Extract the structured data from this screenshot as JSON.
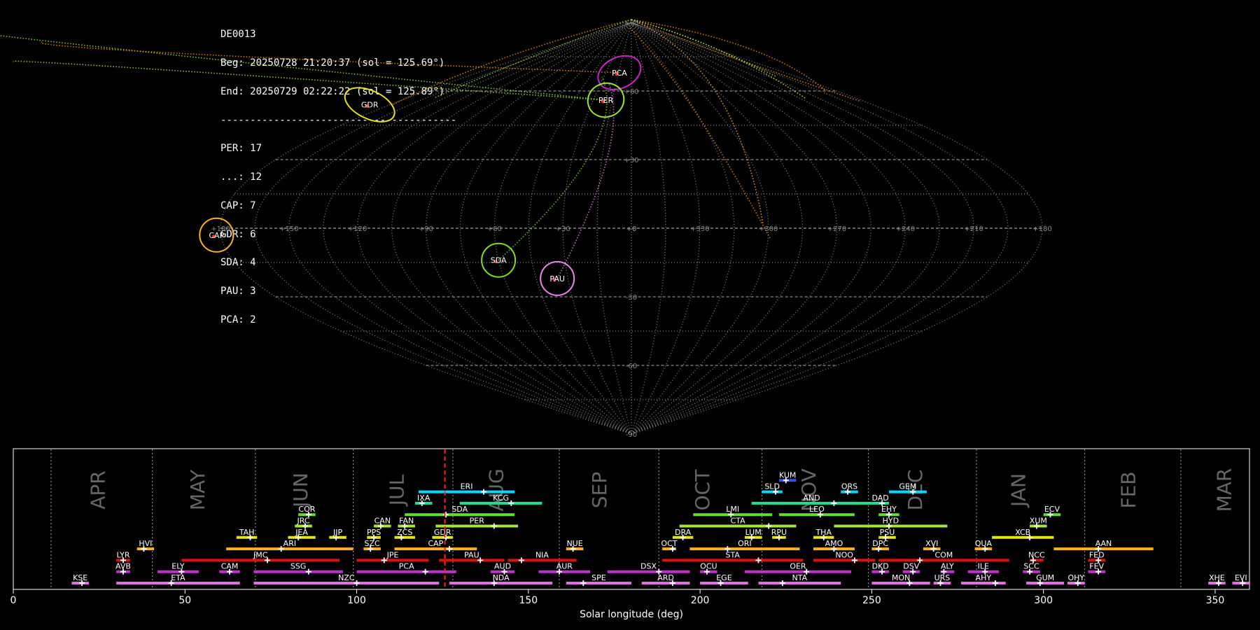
{
  "info": {
    "station": "DE0013",
    "begin": "Beg: 20250728 21:20:37 (sol = 125.69°)",
    "end": "End: 20250729 02:22:22 (sol = 125.89°)",
    "separator": "----------------------------------------",
    "counts": [
      "PER: 17",
      "...: 12",
      "CAP: 7",
      "GDR: 6",
      "SDA: 4",
      "PAU: 3",
      "PCA: 2"
    ]
  },
  "colors": {
    "background": "#000000",
    "PER": "#99e632",
    "CAP": "#ffb020",
    "GDR": "#e6e020",
    "SDA": "#80e020",
    "PAU": "#ee82ee",
    "PCA": "#cc22cc",
    "sporadic": "#ff8800",
    "current_sol": "#ff2020"
  },
  "chart_data": [
    {
      "type": "scatter",
      "projection": "sinusoidal",
      "lon_labels": [
        "+180",
        "+150",
        "+120",
        "+90",
        "+60",
        "+30",
        "+0",
        "+330",
        "+300",
        "+270",
        "+240",
        "+210",
        "+180"
      ],
      "lat_labels": [
        "+90",
        "+60",
        "+30",
        "+0",
        "-30",
        "-60",
        "-90"
      ],
      "radiants": [
        {
          "name": "PCA",
          "lon": -14,
          "lat": 68
        },
        {
          "name": "PER",
          "lon": -20,
          "lat": 56
        },
        {
          "name": "GDR",
          "lon": -195,
          "lat": 54
        },
        {
          "name": "CAP",
          "lon": -182,
          "lat": -3
        },
        {
          "name": "SDA",
          "lon": -60,
          "lat": -14
        },
        {
          "name": "PAU",
          "lon": -35,
          "lat": -22
        }
      ]
    },
    {
      "type": "bar",
      "xlabel": "Solar longitude (deg)",
      "xlim": [
        0,
        360
      ],
      "xticks": [
        0,
        50,
        100,
        150,
        200,
        250,
        300,
        350
      ],
      "current_sol": 125.69,
      "month_boundaries": [
        11,
        40.5,
        70.5,
        99,
        128,
        159,
        188,
        218,
        249,
        280.5,
        312,
        340
      ],
      "months": [
        {
          "name": "APR",
          "sol": 25
        },
        {
          "name": "MAY",
          "sol": 54
        },
        {
          "name": "JUN",
          "sol": 84
        },
        {
          "name": "JUL",
          "sol": 112
        },
        {
          "name": "AUG",
          "sol": 141
        },
        {
          "name": "SEP",
          "sol": 171
        },
        {
          "name": "OCT",
          "sol": 201
        },
        {
          "name": "NOV",
          "sol": 232
        },
        {
          "name": "DEC",
          "sol": 263
        },
        {
          "name": "JAN",
          "sol": 293
        },
        {
          "name": "FEB",
          "sol": 325
        },
        {
          "name": "MAR",
          "sol": 353
        }
      ],
      "showers": [
        {
          "name": "KUM",
          "start": 223,
          "end": 228,
          "peak": 225,
          "row": 10,
          "color": "#3050ff"
        },
        {
          "name": "ERI",
          "start": 118,
          "end": 146,
          "peak": 137,
          "row": 9,
          "color": "#00d8ff"
        },
        {
          "name": "SLD",
          "start": 218,
          "end": 224,
          "peak": 222,
          "row": 9,
          "color": "#00d8ff"
        },
        {
          "name": "ORS",
          "start": 241,
          "end": 246,
          "peak": 243,
          "row": 9,
          "color": "#00d8ff"
        },
        {
          "name": "GEM",
          "start": 255,
          "end": 266,
          "peak": 262,
          "row": 9,
          "color": "#00d8ff"
        },
        {
          "name": "IXA",
          "start": 117,
          "end": 122,
          "peak": 119,
          "row": 8,
          "color": "#20e090"
        },
        {
          "name": "KCG",
          "start": 130,
          "end": 154,
          "peak": 145,
          "row": 8,
          "color": "#20e090"
        },
        {
          "name": "AND",
          "start": 215,
          "end": 250,
          "peak": 239,
          "row": 8,
          "color": "#20e090"
        },
        {
          "name": "DAD",
          "start": 250,
          "end": 255,
          "peak": 253,
          "row": 8,
          "color": "#20e090"
        },
        {
          "name": "COR",
          "start": 83,
          "end": 88,
          "peak": 86,
          "row": 7,
          "color": "#60e030"
        },
        {
          "name": "SDA",
          "start": 114,
          "end": 146,
          "peak": 126,
          "row": 7,
          "color": "#60e030"
        },
        {
          "name": "LMI",
          "start": 198,
          "end": 221,
          "peak": 209,
          "row": 7,
          "color": "#60e030"
        },
        {
          "name": "LEO",
          "start": 223,
          "end": 245,
          "peak": 235,
          "row": 7,
          "color": "#60e030"
        },
        {
          "name": "EHY",
          "start": 252,
          "end": 258,
          "peak": 255,
          "row": 7,
          "color": "#60e030"
        },
        {
          "name": "ECV",
          "start": 300,
          "end": 305,
          "peak": 302,
          "row": 7,
          "color": "#60e030"
        },
        {
          "name": "JRC",
          "start": 82,
          "end": 87,
          "peak": 85,
          "row": 6,
          "color": "#a0e640"
        },
        {
          "name": "CAN",
          "start": 105,
          "end": 110,
          "peak": 107,
          "row": 6,
          "color": "#a0e640"
        },
        {
          "name": "FAN",
          "start": 112,
          "end": 117,
          "peak": 114,
          "row": 6,
          "color": "#a0e640"
        },
        {
          "name": "PER",
          "start": 123,
          "end": 147,
          "peak": 140,
          "row": 6,
          "color": "#a0e640"
        },
        {
          "name": "CTA",
          "start": 194,
          "end": 228,
          "peak": 220,
          "row": 6,
          "color": "#a0e640"
        },
        {
          "name": "HYD",
          "start": 239,
          "end": 272,
          "peak": 255,
          "row": 6,
          "color": "#a0e640"
        },
        {
          "name": "XUM",
          "start": 296,
          "end": 301,
          "peak": 298,
          "row": 6,
          "color": "#a0e640"
        },
        {
          "name": "TAH",
          "start": 65,
          "end": 71,
          "peak": 69,
          "row": 5,
          "color": "#e6e020"
        },
        {
          "name": "JEA",
          "start": 80,
          "end": 88,
          "peak": 83,
          "row": 5,
          "color": "#e6e020"
        },
        {
          "name": "JIP",
          "start": 92,
          "end": 97,
          "peak": 94,
          "row": 5,
          "color": "#e6e020"
        },
        {
          "name": "PPS",
          "start": 103,
          "end": 107,
          "peak": 105,
          "row": 5,
          "color": "#e6e020"
        },
        {
          "name": "ZCS",
          "start": 111,
          "end": 117,
          "peak": 113,
          "row": 5,
          "color": "#e6e020"
        },
        {
          "name": "GDR",
          "start": 122,
          "end": 128,
          "peak": 126,
          "row": 5,
          "color": "#e6e020"
        },
        {
          "name": "DRA",
          "start": 192,
          "end": 198,
          "peak": 195,
          "row": 5,
          "color": "#e6e020"
        },
        {
          "name": "LUM",
          "start": 213,
          "end": 218,
          "peak": 215,
          "row": 5,
          "color": "#e6e020"
        },
        {
          "name": "RPU",
          "start": 221,
          "end": 225,
          "peak": 223,
          "row": 5,
          "color": "#e6e020"
        },
        {
          "name": "THA",
          "start": 233,
          "end": 239,
          "peak": 236,
          "row": 5,
          "color": "#e6e020"
        },
        {
          "name": "PSU",
          "start": 252,
          "end": 257,
          "peak": 254,
          "row": 5,
          "color": "#e6e020"
        },
        {
          "name": "XCB",
          "start": 285,
          "end": 303,
          "peak": 296,
          "row": 5,
          "color": "#e6e020"
        },
        {
          "name": "HVI",
          "start": 36,
          "end": 41,
          "peak": 38,
          "row": 4,
          "color": "#ffb020"
        },
        {
          "name": "ARI",
          "start": 62,
          "end": 99,
          "peak": 78,
          "row": 4,
          "color": "#ffb020"
        },
        {
          "name": "SZC",
          "start": 102,
          "end": 107,
          "peak": 104,
          "row": 4,
          "color": "#ffb020"
        },
        {
          "name": "CAP",
          "start": 111,
          "end": 135,
          "peak": 127,
          "row": 4,
          "color": "#ffb020"
        },
        {
          "name": "NUE",
          "start": 161,
          "end": 166,
          "peak": 163,
          "row": 4,
          "color": "#ffb020"
        },
        {
          "name": "OCT",
          "start": 189,
          "end": 193,
          "peak": 192,
          "row": 4,
          "color": "#ffb020"
        },
        {
          "name": "ORI",
          "start": 197,
          "end": 229,
          "peak": 208,
          "row": 4,
          "color": "#ffb020"
        },
        {
          "name": "AMO",
          "start": 233,
          "end": 245,
          "peak": 239,
          "row": 4,
          "color": "#ffb020"
        },
        {
          "name": "DPC",
          "start": 250,
          "end": 255,
          "peak": 252,
          "row": 4,
          "color": "#ffb020"
        },
        {
          "name": "XVI",
          "start": 265,
          "end": 270,
          "peak": 268,
          "row": 4,
          "color": "#ffb020"
        },
        {
          "name": "QUA",
          "start": 280,
          "end": 285,
          "peak": 283,
          "row": 4,
          "color": "#ffb020"
        },
        {
          "name": "AAN",
          "start": 303,
          "end": 332,
          "peak": 316,
          "row": 4,
          "color": "#ffb020"
        },
        {
          "name": "LYR",
          "start": 30,
          "end": 34,
          "peak": 32,
          "row": 3,
          "color": "#e01010"
        },
        {
          "name": "JMC",
          "start": 49,
          "end": 95,
          "peak": 74,
          "row": 3,
          "color": "#e01010"
        },
        {
          "name": "JPE",
          "start": 100,
          "end": 121,
          "peak": 108,
          "row": 3,
          "color": "#e01010"
        },
        {
          "name": "PAU",
          "start": 124,
          "end": 143,
          "peak": 136,
          "row": 3,
          "color": "#e01010"
        },
        {
          "name": "NIA",
          "start": 144,
          "end": 164,
          "peak": 148,
          "row": 3,
          "color": "#e01010"
        },
        {
          "name": "STA",
          "start": 189,
          "end": 230,
          "peak": 217,
          "row": 3,
          "color": "#e01010"
        },
        {
          "name": "NOO",
          "start": 233,
          "end": 251,
          "peak": 245,
          "row": 3,
          "color": "#e01010"
        },
        {
          "name": "COM",
          "start": 252,
          "end": 290,
          "peak": 264,
          "row": 3,
          "color": "#e01010"
        },
        {
          "name": "NCC",
          "start": 296,
          "end": 300,
          "peak": 297,
          "row": 3,
          "color": "#e01010"
        },
        {
          "name": "FED",
          "start": 313,
          "end": 318,
          "peak": 316,
          "row": 3,
          "color": "#e01010"
        },
        {
          "name": "AVB",
          "start": 30,
          "end": 34,
          "peak": 32,
          "row": 2,
          "color": "#c030d0"
        },
        {
          "name": "ELY",
          "start": 42,
          "end": 54,
          "peak": 49,
          "row": 2,
          "color": "#c030d0"
        },
        {
          "name": "CAM",
          "start": 60,
          "end": 66,
          "peak": 63,
          "row": 2,
          "color": "#c030d0"
        },
        {
          "name": "SSG",
          "start": 70,
          "end": 96,
          "peak": 86,
          "row": 2,
          "color": "#c030d0"
        },
        {
          "name": "PCA",
          "start": 100,
          "end": 129,
          "peak": 120,
          "row": 2,
          "color": "#c030d0"
        },
        {
          "name": "AUD",
          "start": 139,
          "end": 146,
          "peak": 143,
          "row": 2,
          "color": "#c030d0"
        },
        {
          "name": "AUR",
          "start": 153,
          "end": 168,
          "peak": 159,
          "row": 2,
          "color": "#c030d0"
        },
        {
          "name": "DSX",
          "start": 173,
          "end": 197,
          "peak": 188,
          "row": 2,
          "color": "#c030d0"
        },
        {
          "name": "OCU",
          "start": 200,
          "end": 205,
          "peak": 202,
          "row": 2,
          "color": "#c030d0"
        },
        {
          "name": "OER",
          "start": 213,
          "end": 244,
          "peak": 231,
          "row": 2,
          "color": "#c030d0"
        },
        {
          "name": "DKD",
          "start": 250,
          "end": 255,
          "peak": 253,
          "row": 2,
          "color": "#c030d0"
        },
        {
          "name": "DSV",
          "start": 259,
          "end": 264,
          "peak": 262,
          "row": 2,
          "color": "#c030d0"
        },
        {
          "name": "ALY",
          "start": 270,
          "end": 274,
          "peak": 271,
          "row": 2,
          "color": "#c030d0"
        },
        {
          "name": "ILE",
          "start": 278,
          "end": 287,
          "peak": 283,
          "row": 2,
          "color": "#c030d0"
        },
        {
          "name": "SCC",
          "start": 294,
          "end": 299,
          "peak": 296,
          "row": 2,
          "color": "#c030d0"
        },
        {
          "name": "FEV",
          "start": 313,
          "end": 318,
          "peak": 316,
          "row": 2,
          "color": "#c030d0"
        },
        {
          "name": "KSE",
          "start": 17,
          "end": 22,
          "peak": 20,
          "row": 1,
          "color": "#e070e0"
        },
        {
          "name": "ETA",
          "start": 30,
          "end": 66,
          "peak": 46,
          "row": 1,
          "color": "#e070e0"
        },
        {
          "name": "NZC",
          "start": 70,
          "end": 124,
          "peak": 100,
          "row": 1,
          "color": "#e070e0"
        },
        {
          "name": "NDA",
          "start": 127,
          "end": 157,
          "peak": 140,
          "row": 1,
          "color": "#e070e0"
        },
        {
          "name": "SPE",
          "start": 161,
          "end": 180,
          "peak": 166,
          "row": 1,
          "color": "#e070e0"
        },
        {
          "name": "ARD",
          "start": 183,
          "end": 197,
          "peak": 192,
          "row": 1,
          "color": "#e070e0"
        },
        {
          "name": "EGE",
          "start": 200,
          "end": 214,
          "peak": 206,
          "row": 1,
          "color": "#e070e0"
        },
        {
          "name": "NTA",
          "start": 217,
          "end": 241,
          "peak": 224,
          "row": 1,
          "color": "#e070e0"
        },
        {
          "name": "MON",
          "start": 250,
          "end": 267,
          "peak": 261,
          "row": 1,
          "color": "#e070e0"
        },
        {
          "name": "URS",
          "start": 268,
          "end": 273,
          "peak": 270,
          "row": 1,
          "color": "#e070e0"
        },
        {
          "name": "AHY",
          "start": 276,
          "end": 289,
          "peak": 286,
          "row": 1,
          "color": "#e070e0"
        },
        {
          "name": "GUM",
          "start": 295,
          "end": 306,
          "peak": 299,
          "row": 1,
          "color": "#e070e0"
        },
        {
          "name": "OHY",
          "start": 307,
          "end": 312,
          "peak": 310,
          "row": 1,
          "color": "#e070e0"
        },
        {
          "name": "XHE",
          "start": 348,
          "end": 353,
          "peak": 351,
          "row": 1,
          "color": "#e070e0"
        },
        {
          "name": "EVI",
          "start": 355,
          "end": 360,
          "peak": 358,
          "row": 1,
          "color": "#e070e0"
        }
      ]
    }
  ]
}
